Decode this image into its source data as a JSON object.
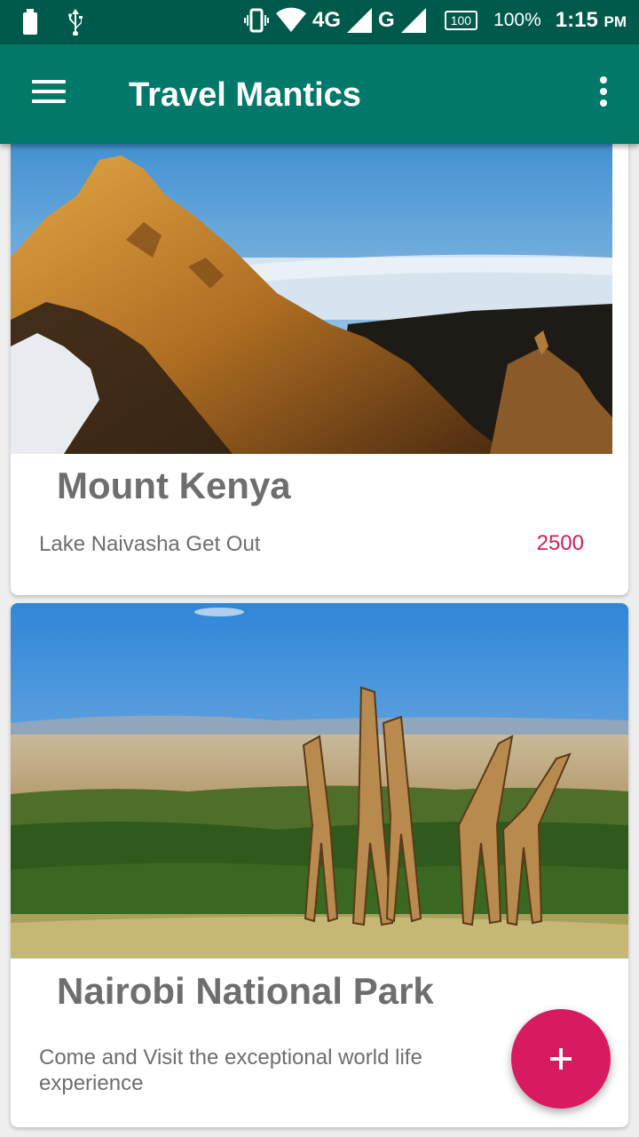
{
  "status_bar": {
    "network_4g": "4G",
    "network_g": "G",
    "battery_box": "100",
    "battery_percent": "100%",
    "time": "1:15",
    "time_suffix": "PM",
    "icons": [
      "battery-icon",
      "usb-icon",
      "vibrate-icon",
      "wifi-icon",
      "signal-icon"
    ]
  },
  "app_bar": {
    "title": "Travel Mantics",
    "menu_icon": "hamburger-menu-icon",
    "overflow_icon": "more-vert-icon",
    "color": "#00796b",
    "status_color": "#005a4c"
  },
  "deals": [
    {
      "title": "Mount Kenya",
      "description": "Lake Naivasha Get Out",
      "price": "2500",
      "image": "mountain-peak-photo"
    },
    {
      "title": "Nairobi National Park",
      "description": "Come and Visit the exceptional world life experience",
      "price": "",
      "image": "giraffes-savanna-photo"
    }
  ],
  "fab": {
    "icon": "plus-icon",
    "color": "#d81b60"
  }
}
